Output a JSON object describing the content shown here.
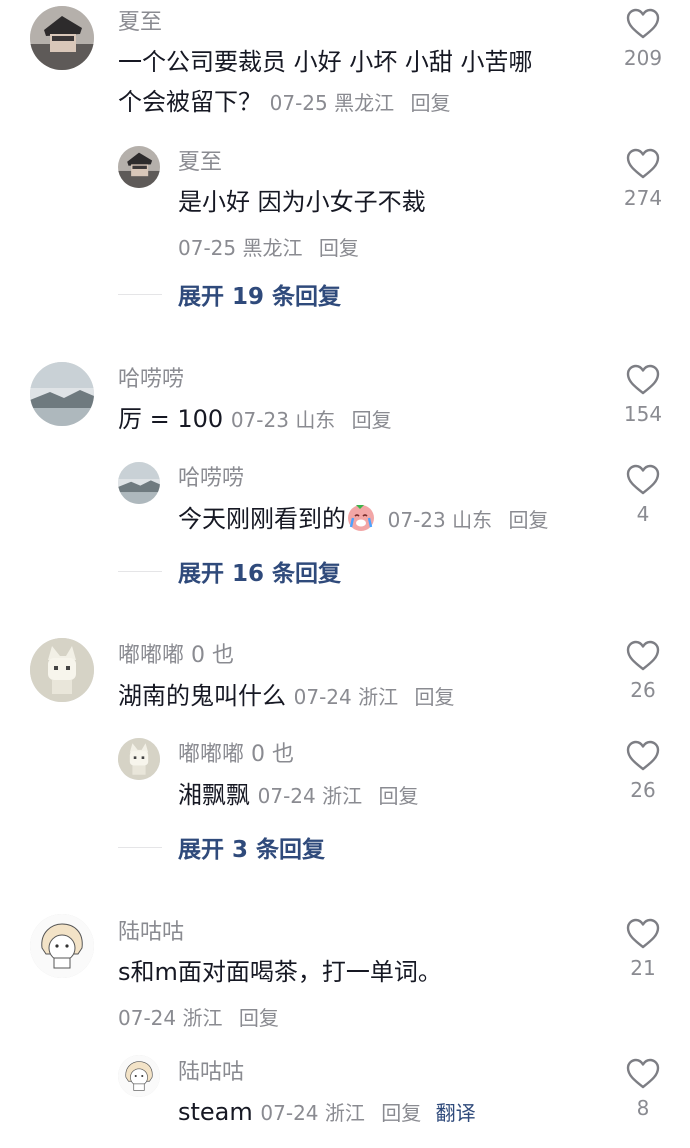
{
  "comments": [
    {
      "user": "夏至",
      "text_line1": "一个公司要裁员 小好 小坏 小甜 小苦哪",
      "text_line2": "个会被留下？",
      "date": "07-25",
      "location": "黑龙江",
      "reply_label": "回复",
      "likes": "209",
      "reply": {
        "user": "夏至",
        "text": "是小好 因为小女子不裁",
        "date": "07-25",
        "location": "黑龙江",
        "reply_label": "回复",
        "likes": "274"
      },
      "expand_label": "展开 19 条回复"
    },
    {
      "user": "哈唠唠",
      "text": "厉 = 100",
      "date": "07-23",
      "location": "山东",
      "reply_label": "回复",
      "likes": "154",
      "reply": {
        "user": "哈唠唠",
        "text": "今天刚刚看到的",
        "emoji": "crying-face-emoji",
        "date": "07-23",
        "location": "山东",
        "reply_label": "回复",
        "likes": "4"
      },
      "expand_label": "展开 16 条回复"
    },
    {
      "user": "嘟嘟嘟 0 也",
      "text": "湖南的鬼叫什么",
      "date": "07-24",
      "location": "浙江",
      "reply_label": "回复",
      "likes": "26",
      "reply": {
        "user": "嘟嘟嘟 0 也",
        "text": "湘飘飘",
        "date": "07-24",
        "location": "浙江",
        "reply_label": "回复",
        "likes": "26"
      },
      "expand_label": "展开 3 条回复"
    },
    {
      "user": "陆咕咕",
      "text": "s和m面对面喝茶，打一单词。",
      "date": "07-24",
      "location": "浙江",
      "reply_label": "回复",
      "likes": "21",
      "reply": {
        "user": "陆咕咕",
        "text": "steam",
        "date": "07-24",
        "location": "浙江",
        "reply_label": "回复",
        "translate_label": "翻译",
        "likes": "8"
      }
    }
  ],
  "icons": {
    "like": "heart-outline-icon"
  },
  "colors": {
    "link": "#2f4a7b",
    "secondary_text": "#8a8b91",
    "primary_text": "#161823"
  }
}
